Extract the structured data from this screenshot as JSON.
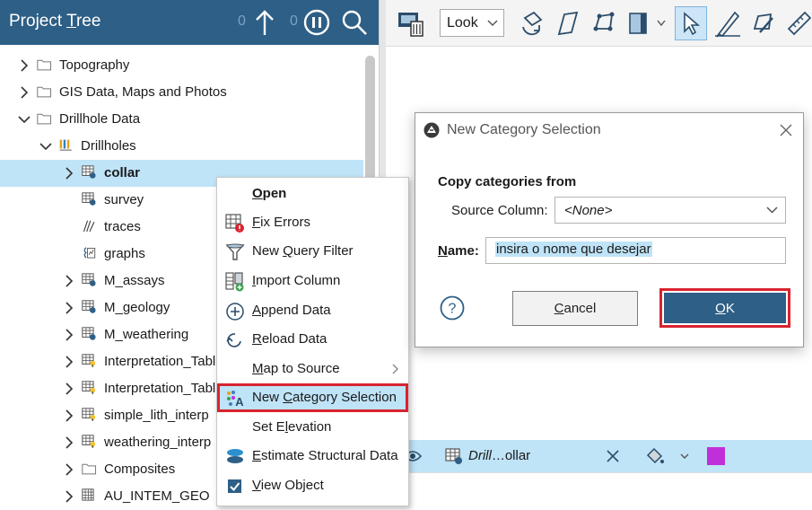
{
  "project_tree": {
    "title": "Project Tree",
    "counter_left": "0",
    "counter_right": "0",
    "items": [
      {
        "label": "Topography",
        "icon": "folder-icon",
        "level": 0,
        "arrow": "collapsed"
      },
      {
        "label": "GIS Data, Maps and Photos",
        "icon": "folder-icon",
        "level": 0,
        "arrow": "collapsed"
      },
      {
        "label": "Drillhole Data",
        "icon": "folder-icon",
        "level": 0,
        "arrow": "expanded"
      },
      {
        "label": "Drillholes",
        "icon": "drillholes-icon",
        "level": 1,
        "arrow": "expanded"
      },
      {
        "label": "collar",
        "icon": "table-icon",
        "level": 2,
        "arrow": "collapsed",
        "selected": true
      },
      {
        "label": "survey",
        "icon": "table-icon",
        "level": 2,
        "arrow": "none"
      },
      {
        "label": "traces",
        "icon": "traces-icon",
        "level": 2,
        "arrow": "none"
      },
      {
        "label": "graphs",
        "icon": "graphs-icon",
        "level": 2,
        "arrow": "none"
      },
      {
        "label": "M_assays",
        "icon": "table-icon",
        "level": 2,
        "arrow": "collapsed"
      },
      {
        "label": "M_geology",
        "icon": "table-icon",
        "level": 2,
        "arrow": "collapsed"
      },
      {
        "label": "M_weathering",
        "icon": "table-icon",
        "level": 2,
        "arrow": "collapsed"
      },
      {
        "label": "Interpretation_Table",
        "icon": "interp-table-icon",
        "level": 2,
        "arrow": "collapsed"
      },
      {
        "label": "Interpretation_Table",
        "icon": "interp-table-icon",
        "level": 2,
        "arrow": "collapsed"
      },
      {
        "label": "simple_lith_interp",
        "icon": "interp-table-icon",
        "level": 2,
        "arrow": "collapsed"
      },
      {
        "label": "weathering_interp",
        "icon": "interp-table-icon",
        "level": 2,
        "arrow": "collapsed"
      },
      {
        "label": "Composites",
        "icon": "folder-icon",
        "level": 2,
        "arrow": "collapsed"
      },
      {
        "label": "AU_INTEM_GEO",
        "icon": "grid-table-icon",
        "level": 2,
        "arrow": "collapsed"
      }
    ]
  },
  "toolbar": {
    "look_select": "Look"
  },
  "context_menu": {
    "items": [
      {
        "label": "Open",
        "icon": "",
        "bold": true,
        "ul": 0
      },
      {
        "label": "Fix Errors",
        "icon": "fix-errors-icon",
        "ul": 0
      },
      {
        "label": "New Query Filter",
        "icon": "query-filter-icon",
        "ul": 4
      },
      {
        "label": "Import Column",
        "icon": "import-column-icon",
        "ul": 0
      },
      {
        "label": "Append Data",
        "icon": "append-data-icon",
        "ul": 0
      },
      {
        "label": "Reload Data",
        "icon": "reload-data-icon",
        "ul": 0
      },
      {
        "label": "Map to Source",
        "icon": "",
        "ul": 0,
        "submenu": true
      },
      {
        "label": "New Category Selection",
        "icon": "category-selection-icon",
        "ul": 4,
        "highlight": true
      },
      {
        "label": "Set Elevation",
        "icon": "",
        "ul": 5
      },
      {
        "label": "Estimate Structural Data",
        "icon": "structural-data-icon",
        "ul": 0
      },
      {
        "label": "View Object",
        "icon": "checkbox-checked-icon",
        "ul": 0
      }
    ]
  },
  "dialog": {
    "title": "New Category Selection",
    "copy_heading": "Copy categories from",
    "source_label": "Source Column:",
    "source_value": "<None>",
    "name_label": "Name:",
    "name_value": "insira o nome que desejar",
    "cancel_label": "Cancel",
    "ok_label": "OK"
  },
  "scene_list": {
    "label_italic": "Drill",
    "label_rest": "…ollar",
    "swatch_color": "#c030d8"
  },
  "colors": {
    "header_blue": "#2e5f86",
    "selection_blue": "#bfe3f7",
    "highlight_red": "#d9232f"
  }
}
